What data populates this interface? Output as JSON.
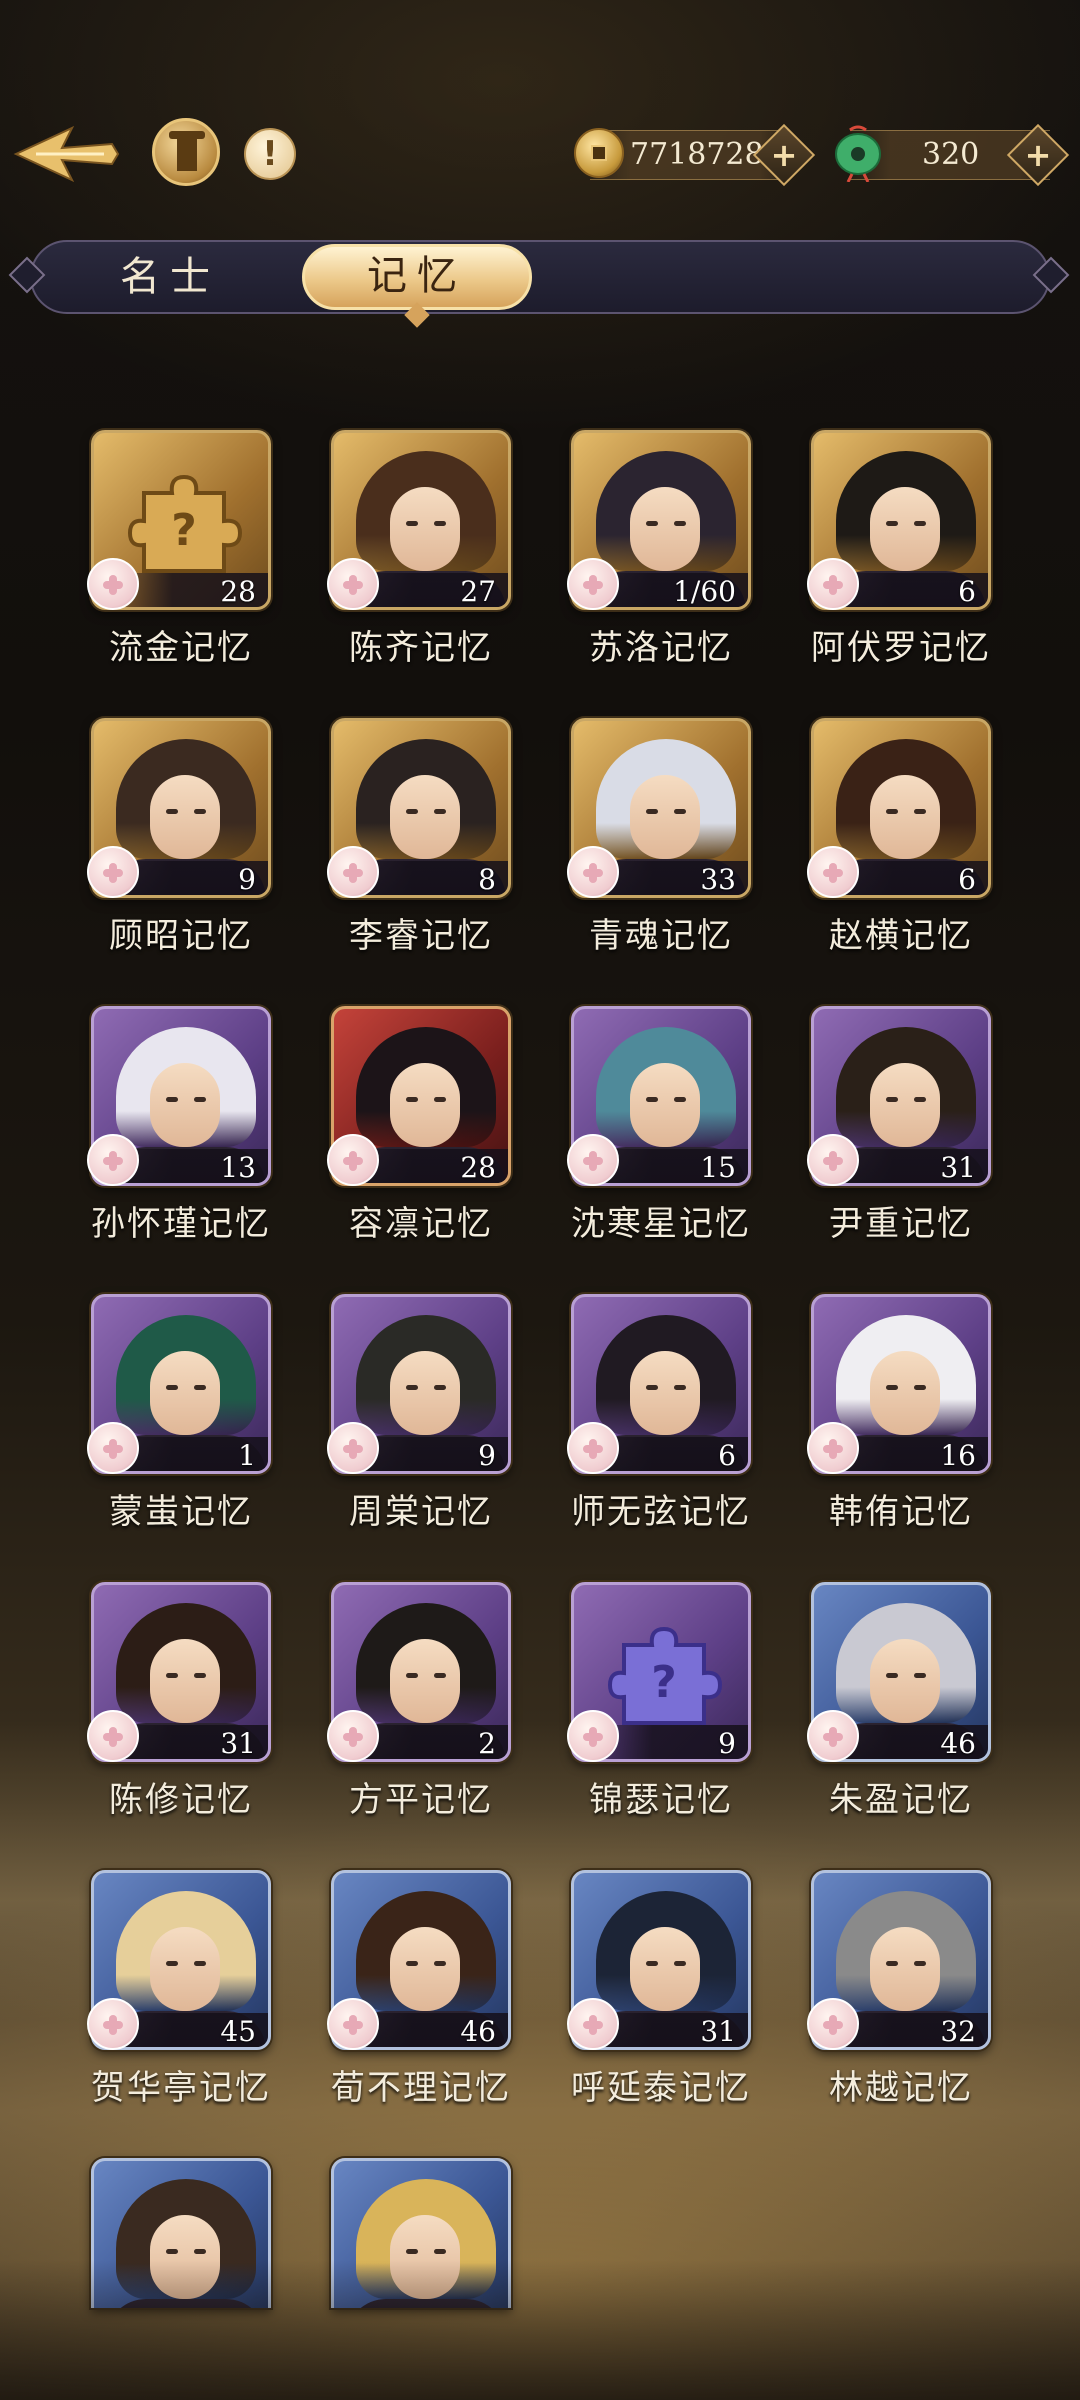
{
  "header": {
    "gold_amount": "7718728",
    "jade_amount": "320",
    "plus_symbol": "+"
  },
  "tabs": [
    {
      "label": "名士",
      "active": false
    },
    {
      "label": "记忆",
      "active": true
    }
  ],
  "memories": [
    {
      "name": "流金记忆",
      "count": "28",
      "frame": "gold",
      "type": "puzzle"
    },
    {
      "name": "陈齐记忆",
      "count": "27",
      "frame": "gold",
      "type": "portrait"
    },
    {
      "name": "苏洛记忆",
      "count": "1/60",
      "frame": "gold",
      "type": "portrait"
    },
    {
      "name": "阿伏罗记忆",
      "count": "6",
      "frame": "gold",
      "type": "portrait"
    },
    {
      "name": "顾昭记忆",
      "count": "9",
      "frame": "gold",
      "type": "portrait"
    },
    {
      "name": "李睿记忆",
      "count": "8",
      "frame": "gold",
      "type": "portrait"
    },
    {
      "name": "青魂记忆",
      "count": "33",
      "frame": "gold",
      "type": "portrait"
    },
    {
      "name": "赵横记忆",
      "count": "6",
      "frame": "gold",
      "type": "portrait"
    },
    {
      "name": "孙怀瑾记忆",
      "count": "13",
      "frame": "purple",
      "type": "portrait"
    },
    {
      "name": "容凛记忆",
      "count": "28",
      "frame": "red",
      "type": "portrait"
    },
    {
      "name": "沈寒星记忆",
      "count": "15",
      "frame": "purple",
      "type": "portrait"
    },
    {
      "name": "尹重记忆",
      "count": "31",
      "frame": "purple",
      "type": "portrait"
    },
    {
      "name": "蒙蚩记忆",
      "count": "1",
      "frame": "purple",
      "type": "portrait"
    },
    {
      "name": "周棠记忆",
      "count": "9",
      "frame": "purple",
      "type": "portrait"
    },
    {
      "name": "师无弦记忆",
      "count": "6",
      "frame": "purple",
      "type": "portrait"
    },
    {
      "name": "韩侑记忆",
      "count": "16",
      "frame": "purple",
      "type": "portrait"
    },
    {
      "name": "陈修记忆",
      "count": "31",
      "frame": "purple",
      "type": "portrait"
    },
    {
      "name": "方平记忆",
      "count": "2",
      "frame": "purple",
      "type": "portrait"
    },
    {
      "name": "锦瑟记忆",
      "count": "9",
      "frame": "purple",
      "type": "puzzle"
    },
    {
      "name": "朱盈记忆",
      "count": "46",
      "frame": "blue",
      "type": "portrait"
    },
    {
      "name": "贺华亭记忆",
      "count": "45",
      "frame": "blue",
      "type": "portrait"
    },
    {
      "name": "荀不理记忆",
      "count": "46",
      "frame": "blue",
      "type": "portrait"
    },
    {
      "name": "呼延泰记忆",
      "count": "31",
      "frame": "blue",
      "type": "portrait"
    },
    {
      "name": "林越记忆",
      "count": "32",
      "frame": "blue",
      "type": "portrait"
    },
    {
      "name": "",
      "count": "",
      "frame": "blue",
      "type": "portrait",
      "partial": true
    },
    {
      "name": "",
      "count": "",
      "frame": "blue",
      "type": "portrait",
      "partial": true
    }
  ],
  "hair_colors": [
    "#3a2518",
    "#4a2e1c",
    "#2b2430",
    "#1e1a16",
    "#3b2a20",
    "#2a2220",
    "#d9dce6",
    "#3a2216",
    "#e8e6ef",
    "#1c1418",
    "#4f8a9a",
    "#2a2018",
    "#1f5a48",
    "#2a2a26",
    "#201a22",
    "#efeef2",
    "#2c1d16",
    "#1e1a18",
    "#000000",
    "#c9c9d2",
    "#e6cf9a",
    "#3a2418",
    "#1c2436",
    "#8a8a8a",
    "#3a2a20",
    "#d9b45a"
  ],
  "colors": {
    "gold_frame": "#c9a765",
    "purple_frame": "#b9a0d4",
    "blue_frame": "#b3c2de",
    "active_tab": "#ecc98a",
    "text_light": "#f3ecdc"
  }
}
